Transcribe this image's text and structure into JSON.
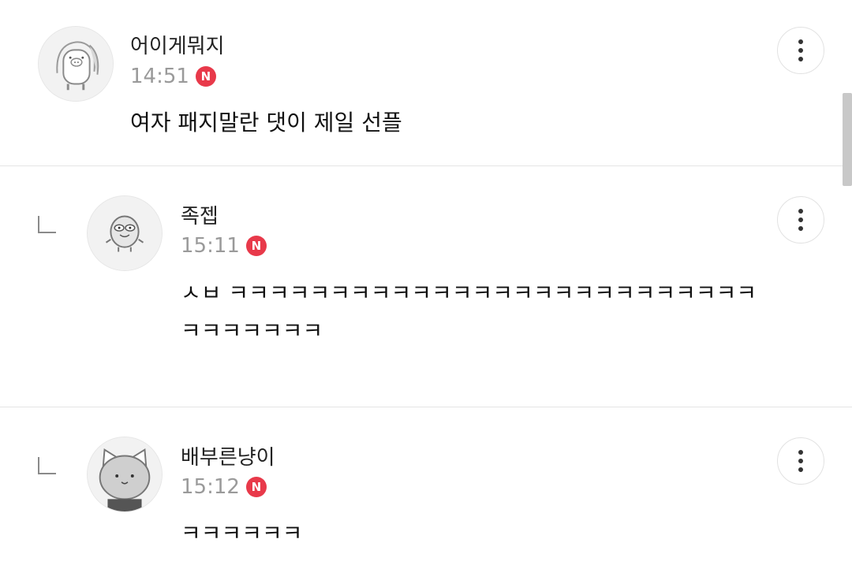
{
  "comments": [
    {
      "author": "어이게뭐지",
      "time": "14:51",
      "new_badge": "N",
      "text": "여자 패지말란 댓이 제일 선플",
      "avatar_icon": "pig-character-avatar-icon",
      "is_reply": false
    },
    {
      "author": "족젭",
      "time": "15:11",
      "new_badge": "N",
      "text": "ㅅㅂ ㅋㅋㅋㅋㅋㅋㅋㅋㅋㅋㅋㅋㅋㅋㅋㅋㅋㅋㅋㅋㅋㅋㅋㅋㅋㅋㅋㅋㅋㅋㅋㅋㅋ",
      "avatar_icon": "duck-character-avatar-icon",
      "is_reply": true
    },
    {
      "author": "배부른냥이",
      "time": "15:12",
      "new_badge": "N",
      "text": "ㅋㅋㅋㅋㅋㅋ",
      "avatar_icon": "cat-character-avatar-icon",
      "is_reply": true
    }
  ],
  "icons": {
    "reply": "reply-arrow-icon",
    "more": "more-vertical-icon"
  },
  "colors": {
    "badge": "#e8394a",
    "time": "#9a9a9a",
    "divider": "#e4e4e4"
  }
}
